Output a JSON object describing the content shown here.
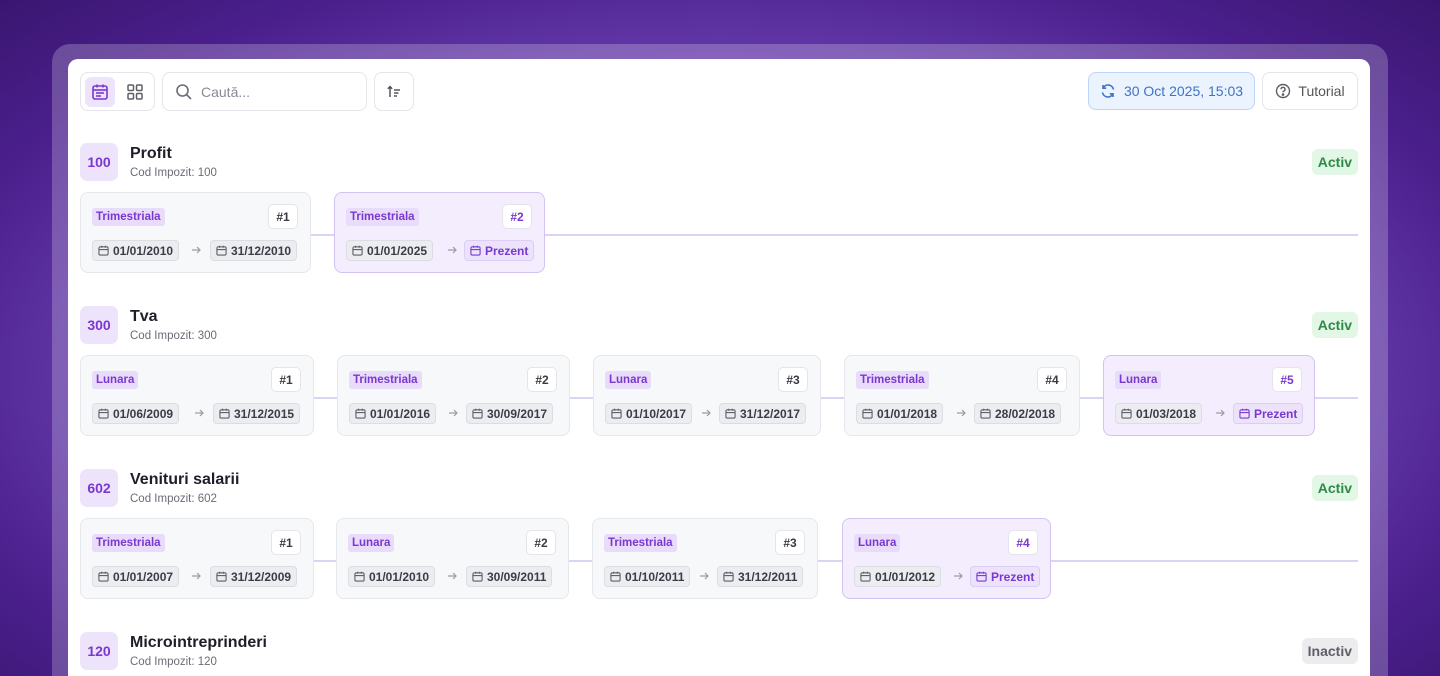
{
  "toolbar": {
    "search_placeholder": "Caută...",
    "refresh_label": "30 Oct 2025, 15:03",
    "tutorial_label": "Tutorial"
  },
  "sections": [
    {
      "code": "100",
      "title": "Profit",
      "subtitle": "Cod Impozit: 100",
      "status": "Activ",
      "periods": [
        {
          "freq": "Trimestriala",
          "num": "#1",
          "start": "01/01/2010",
          "end": "31/12/2010"
        },
        {
          "freq": "Trimestriala",
          "num": "#2",
          "start": "01/01/2025",
          "end": "Prezent"
        }
      ]
    },
    {
      "code": "300",
      "title": "Tva",
      "subtitle": "Cod Impozit: 300",
      "status": "Activ",
      "periods": [
        {
          "freq": "Lunara",
          "num": "#1",
          "start": "01/06/2009",
          "end": "31/12/2015"
        },
        {
          "freq": "Trimestriala",
          "num": "#2",
          "start": "01/01/2016",
          "end": "30/09/2017"
        },
        {
          "freq": "Lunara",
          "num": "#3",
          "start": "01/10/2017",
          "end": "31/12/2017"
        },
        {
          "freq": "Trimestriala",
          "num": "#4",
          "start": "01/01/2018",
          "end": "28/02/2018"
        },
        {
          "freq": "Lunara",
          "num": "#5",
          "start": "01/03/2018",
          "end": "Prezent"
        }
      ]
    },
    {
      "code": "602",
      "title": "Venituri salarii",
      "subtitle": "Cod Impozit: 602",
      "status": "Activ",
      "periods": [
        {
          "freq": "Trimestriala",
          "num": "#1",
          "start": "01/01/2007",
          "end": "31/12/2009"
        },
        {
          "freq": "Lunara",
          "num": "#2",
          "start": "01/01/2010",
          "end": "30/09/2011"
        },
        {
          "freq": "Trimestriala",
          "num": "#3",
          "start": "01/10/2011",
          "end": "31/12/2011"
        },
        {
          "freq": "Lunara",
          "num": "#4",
          "start": "01/01/2012",
          "end": "Prezent"
        }
      ]
    },
    {
      "code": "120",
      "title": "Microintreprinderi",
      "subtitle": "Cod Impozit: 120",
      "status": "Inactiv"
    }
  ],
  "icons": {
    "calendar_view": "calendar-icon",
    "grid_view": "grid-icon",
    "search": "search-icon",
    "sort": "sort-icon",
    "refresh": "refresh-icon",
    "help": "help-circle-icon",
    "date": "calendar-small-icon",
    "arrow": "arrow-right-icon"
  },
  "colors": {
    "accent": "#7a38cf",
    "active_status": "#2f8a48",
    "refresh_text": "#3f74c4"
  }
}
